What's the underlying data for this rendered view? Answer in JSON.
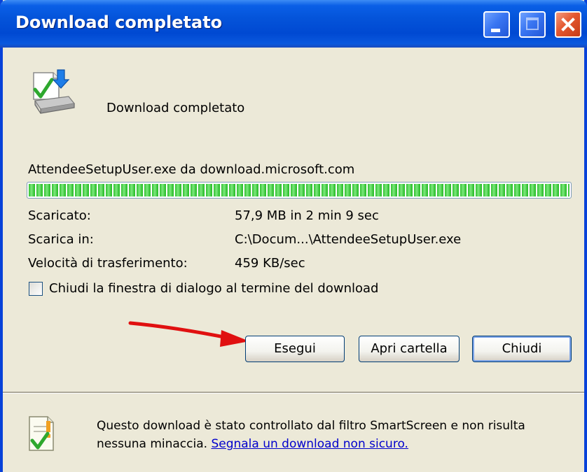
{
  "window": {
    "title": "Download completato"
  },
  "header": {
    "text": "Download completato"
  },
  "file": {
    "description": "AttendeeSetupUser.exe da download.microsoft.com"
  },
  "progress": {
    "fraction": 1.0
  },
  "details": [
    {
      "label": "Scaricato:",
      "value": "57,9 MB in 2 min 9 sec"
    },
    {
      "label": "Scarica in:",
      "value": "C:\\Docum...\\AttendeeSetupUser.exe"
    },
    {
      "label": "Velocità di trasferimento:",
      "value": "459 KB/sec"
    }
  ],
  "close_on_complete": {
    "label": "Chiudi la finestra di dialogo al termine del download",
    "checked": false
  },
  "buttons": {
    "run": "Esegui",
    "open_folder": "Apri cartella",
    "close": "Chiudi"
  },
  "footer": {
    "text": "Questo download è stato controllato dal filtro SmartScreen e non risulta nessuna minaccia. ",
    "link": "Segnala un download non sicuro."
  },
  "colors": {
    "title_bar": "#0453d9",
    "window_bg": "#ece9d8",
    "progress": "#2fc02f",
    "annotation_arrow": "#e01010",
    "link": "#0000cc"
  },
  "icons": [
    "download-complete-icon",
    "minimize-icon",
    "maximize-icon",
    "close-icon",
    "smartscreen-check-icon"
  ]
}
